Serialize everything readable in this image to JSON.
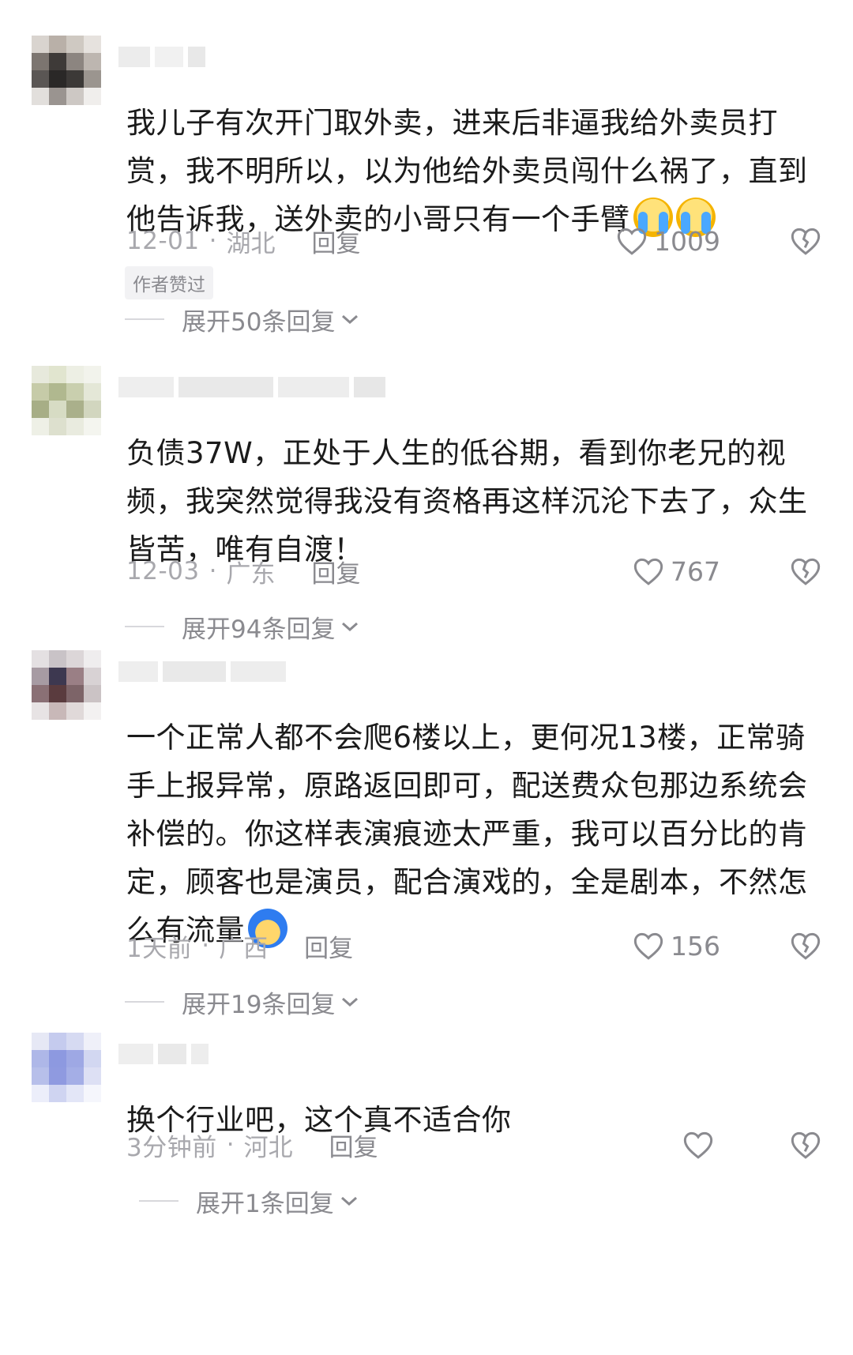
{
  "comments": [
    {
      "text": "我儿子有次开门取外卖，进来后非逼我给外卖员打赏，我不明所以，以为他给外卖员闯什么祸了，直到他告诉我，送外卖的小哥只有一个手臂",
      "emoji": "loudly-crying-face",
      "date": "12-01",
      "dot": "·",
      "location": "湖北",
      "reply": "回复",
      "likes": "1009",
      "badge": "作者赞过",
      "expand": "展开50条回复"
    },
    {
      "text": "负债37W，正处于人生的低谷期，看到你老兄的视频，我突然觉得我没有资格再这样沉沦下去了，众生皆苦，唯有自渡！",
      "date": "12-03",
      "dot": "·",
      "location": "广东",
      "reply": "回复",
      "likes": "767",
      "expand": "展开94条回复"
    },
    {
      "text": "一个正常人都不会爬6楼以上，更何况13楼，正常骑手上报异常，原路返回即可，配送费众包那边系统会补偿的。你这样表演痕迹太严重，我可以百分比的肯定，顾客也是演员，配合演戏的，全是剧本，不然怎么有流量",
      "emoji": "face-behind-hair",
      "date": "1天前",
      "dot": "·",
      "location": "广西",
      "reply": "回复",
      "likes": "156",
      "expand": "展开19条回复"
    },
    {
      "text": "换个行业吧，这个真不适合你",
      "date": "3分钟前",
      "dot": "·",
      "location": "河北",
      "reply": "回复",
      "likes": "",
      "expand": "展开1条回复"
    }
  ],
  "icons": {
    "like": "heart-outline-icon",
    "dislike": "broken-heart-icon",
    "expand": "chevron-down-icon"
  },
  "colors": {
    "text": "#1b1b1b",
    "meta": "#a8a8ad",
    "secondary": "#8a8a8f"
  }
}
